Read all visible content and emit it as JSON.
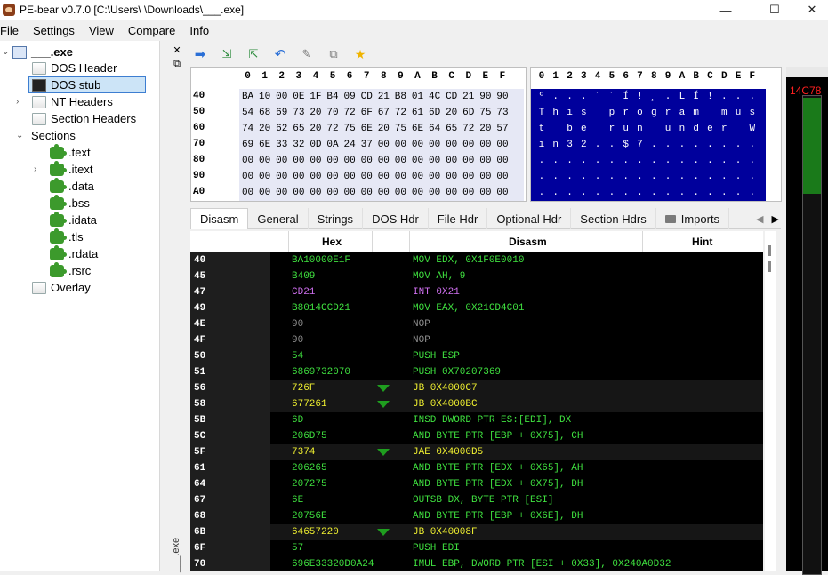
{
  "window": {
    "title": "PE-bear v0.7.0 [C:\\Users\\   \\Downloads\\___.exe]",
    "minimize": "—",
    "maximize": "☐",
    "close": "✕"
  },
  "menu": [
    "File",
    "Settings",
    "View",
    "Compare",
    "Info"
  ],
  "tree": {
    "root": "___.exe",
    "items": [
      {
        "label": "DOS Header"
      },
      {
        "label": "DOS stub"
      },
      {
        "label": "NT Headers"
      },
      {
        "label": "Section Headers"
      },
      {
        "label": "Sections"
      },
      {
        "label": ".text"
      },
      {
        "label": ".itext"
      },
      {
        "label": ".data"
      },
      {
        "label": ".bss"
      },
      {
        "label": ".idata"
      },
      {
        "label": ".tls"
      },
      {
        "label": ".rdata"
      },
      {
        "label": ".rsrc"
      },
      {
        "label": "Overlay"
      }
    ]
  },
  "side_strip": {
    "close": "✕",
    "float": "⧉",
    "dock_label": "___.exe"
  },
  "toolbar": [
    "arrow-right-icon",
    "export-icon",
    "import-icon",
    "undo-icon",
    "pin-icon",
    "compare-icon",
    "star-icon"
  ],
  "hex": {
    "columns": [
      "0",
      "1",
      "2",
      "3",
      "4",
      "5",
      "6",
      "7",
      "8",
      "9",
      "A",
      "B",
      "C",
      "D",
      "E",
      "F"
    ],
    "rows": [
      {
        "offset": "40",
        "bytes": [
          "BA",
          "10",
          "00",
          "0E",
          "1F",
          "B4",
          "09",
          "CD",
          "21",
          "B8",
          "01",
          "4C",
          "CD",
          "21",
          "90",
          "90"
        ]
      },
      {
        "offset": "50",
        "bytes": [
          "54",
          "68",
          "69",
          "73",
          "20",
          "70",
          "72",
          "6F",
          "67",
          "72",
          "61",
          "6D",
          "20",
          "6D",
          "75",
          "73"
        ]
      },
      {
        "offset": "60",
        "bytes": [
          "74",
          "20",
          "62",
          "65",
          "20",
          "72",
          "75",
          "6E",
          "20",
          "75",
          "6E",
          "64",
          "65",
          "72",
          "20",
          "57"
        ]
      },
      {
        "offset": "70",
        "bytes": [
          "69",
          "6E",
          "33",
          "32",
          "0D",
          "0A",
          "24",
          "37",
          "00",
          "00",
          "00",
          "00",
          "00",
          "00",
          "00",
          "00"
        ]
      },
      {
        "offset": "80",
        "bytes": [
          "00",
          "00",
          "00",
          "00",
          "00",
          "00",
          "00",
          "00",
          "00",
          "00",
          "00",
          "00",
          "00",
          "00",
          "00",
          "00"
        ]
      },
      {
        "offset": "90",
        "bytes": [
          "00",
          "00",
          "00",
          "00",
          "00",
          "00",
          "00",
          "00",
          "00",
          "00",
          "00",
          "00",
          "00",
          "00",
          "00",
          "00"
        ]
      },
      {
        "offset": "A0",
        "bytes": [
          "00",
          "00",
          "00",
          "00",
          "00",
          "00",
          "00",
          "00",
          "00",
          "00",
          "00",
          "00",
          "00",
          "00",
          "00",
          "00"
        ]
      }
    ]
  },
  "ascii": {
    "columns": [
      "0",
      "1",
      "2",
      "3",
      "4",
      "5",
      "6",
      "7",
      "8",
      "9",
      "A",
      "B",
      "C",
      "D",
      "E",
      "F"
    ],
    "rows": [
      [
        "º",
        ".",
        ".",
        ".",
        "´",
        "´",
        "Í",
        "!",
        "¸",
        ".",
        "L",
        "Í",
        "!",
        ".",
        ".",
        "."
      ],
      [
        "T",
        "h",
        "i",
        "s",
        " ",
        "p",
        "r",
        "o",
        "g",
        "r",
        "a",
        "m",
        " ",
        "m",
        "u",
        "s"
      ],
      [
        "t",
        " ",
        "b",
        "e",
        " ",
        "r",
        "u",
        "n",
        " ",
        "u",
        "n",
        "d",
        "e",
        "r",
        " ",
        "W"
      ],
      [
        "i",
        "n",
        "3",
        "2",
        ".",
        ".",
        "$",
        "7",
        ".",
        ".",
        ".",
        ".",
        ".",
        ".",
        ".",
        "."
      ],
      [
        ".",
        ".",
        ".",
        ".",
        ".",
        ".",
        ".",
        ".",
        ".",
        ".",
        ".",
        ".",
        ".",
        ".",
        ".",
        "."
      ],
      [
        ".",
        ".",
        ".",
        ".",
        ".",
        ".",
        ".",
        ".",
        ".",
        ".",
        ".",
        ".",
        ".",
        ".",
        ".",
        "."
      ],
      [
        ".",
        ".",
        ".",
        ".",
        ".",
        ".",
        ".",
        ".",
        ".",
        ".",
        ".",
        ".",
        ".",
        ".",
        ".",
        "."
      ]
    ]
  },
  "tabs": [
    "Disasm",
    "General",
    "Strings",
    "DOS Hdr",
    "File Hdr",
    "Optional Hdr",
    "Section Hdrs",
    "Imports"
  ],
  "tab_scroll": {
    "left": "◀",
    "right": "▶"
  },
  "disasm": {
    "headers": {
      "hex": "Hex",
      "disasm": "Disasm",
      "hint": "Hint"
    },
    "colors": {
      "normal": "#3fe03f",
      "int": "#d070f0",
      "nop": "#909090",
      "jump": "#f0f030"
    },
    "rows": [
      {
        "offset": "40",
        "hex": "BA10000E1F",
        "asm": "MOV EDX, 0X1F0E0010",
        "kind": "normal",
        "jump": false
      },
      {
        "offset": "45",
        "hex": "B409",
        "asm": "MOV AH, 9",
        "kind": "normal",
        "jump": false
      },
      {
        "offset": "47",
        "hex": "CD21",
        "asm": "INT 0X21",
        "kind": "int",
        "jump": false
      },
      {
        "offset": "49",
        "hex": "B8014CCD21",
        "asm": "MOV EAX, 0X21CD4C01",
        "kind": "normal",
        "jump": false
      },
      {
        "offset": "4E",
        "hex": "90",
        "asm": "NOP",
        "kind": "nop",
        "jump": false
      },
      {
        "offset": "4F",
        "hex": "90",
        "asm": "NOP",
        "kind": "nop",
        "jump": false
      },
      {
        "offset": "50",
        "hex": "54",
        "asm": "PUSH ESP",
        "kind": "normal",
        "jump": false
      },
      {
        "offset": "51",
        "hex": "6869732070",
        "asm": "PUSH 0X70207369",
        "kind": "normal",
        "jump": false
      },
      {
        "offset": "56",
        "hex": "726F",
        "asm": "JB 0X4000C7",
        "kind": "jump",
        "jump": true
      },
      {
        "offset": "58",
        "hex": "677261",
        "asm": "JB 0X4000BC",
        "kind": "jump",
        "jump": true
      },
      {
        "offset": "5B",
        "hex": "6D",
        "asm": "INSD DWORD PTR ES:[EDI], DX",
        "kind": "normal",
        "jump": false
      },
      {
        "offset": "5C",
        "hex": "206D75",
        "asm": "AND BYTE PTR [EBP + 0X75], CH",
        "kind": "normal",
        "jump": false
      },
      {
        "offset": "5F",
        "hex": "7374",
        "asm": "JAE 0X4000D5",
        "kind": "jump",
        "jump": true
      },
      {
        "offset": "61",
        "hex": "206265",
        "asm": "AND BYTE PTR [EDX + 0X65], AH",
        "kind": "normal",
        "jump": false
      },
      {
        "offset": "64",
        "hex": "207275",
        "asm": "AND BYTE PTR [EDX + 0X75], DH",
        "kind": "normal",
        "jump": false
      },
      {
        "offset": "67",
        "hex": "6E",
        "asm": "OUTSB DX, BYTE PTR [ESI]",
        "kind": "normal",
        "jump": false
      },
      {
        "offset": "68",
        "hex": "20756E",
        "asm": "AND BYTE PTR [EBP + 0X6E], DH",
        "kind": "normal",
        "jump": false
      },
      {
        "offset": "6B",
        "hex": "64657220",
        "asm": "JB 0X40008F",
        "kind": "jump",
        "jump": true
      },
      {
        "offset": "6F",
        "hex": "57",
        "asm": "PUSH EDI",
        "kind": "normal",
        "jump": false
      },
      {
        "offset": "70",
        "hex": "696E33320D0A24",
        "asm": "IMUL EBP, DWORD PTR [ESI + 0X33], 0X240A0D32",
        "kind": "normal",
        "jump": false
      }
    ]
  },
  "overview": {
    "label": "14C78",
    "fill_fraction": 0.2
  }
}
